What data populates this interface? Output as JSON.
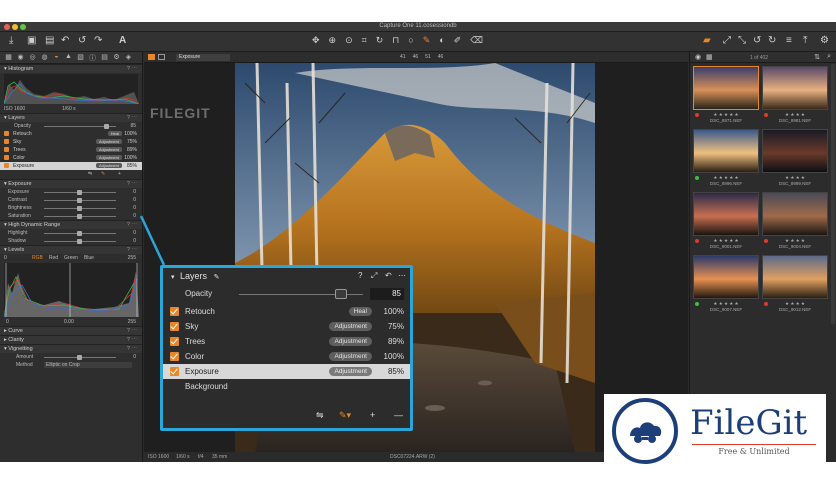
{
  "window": {
    "title": "Capture One 11.cosessiondb"
  },
  "toolbar": {
    "left_icons": [
      "import-icon",
      "camera-icon",
      "folder-icon",
      "undo-icon",
      "redo-icon",
      "text-icon"
    ],
    "center_icons": [
      "pan-icon",
      "loupe-icon",
      "crop-icon",
      "rotate-icon",
      "keystone-icon",
      "mask-icon",
      "brush-icon",
      "eraser-icon",
      "picker-icon"
    ],
    "right_icons": [
      "exposure-warning-icon",
      "expand-icon",
      "compare-icon",
      "rotate-left-icon",
      "rotate-right-icon",
      "settings-icon",
      "export-icon"
    ]
  },
  "left_panel": {
    "histogram": {
      "title": "Histogram",
      "iso": "ISO 1600",
      "shutter": "1/60 s"
    },
    "layers": {
      "title": "Layers",
      "opacity_label": "Opacity",
      "opacity_value": "85",
      "rows": [
        {
          "name": "Retouch",
          "tag": "Heal",
          "pct": "100%"
        },
        {
          "name": "Sky",
          "tag": "Adjustment",
          "pct": "75%"
        },
        {
          "name": "Trees",
          "tag": "Adjustment",
          "pct": "89%"
        },
        {
          "name": "Color",
          "tag": "Adjustment",
          "pct": "100%"
        },
        {
          "name": "Exposure",
          "tag": "Adjustment",
          "pct": "85%"
        }
      ]
    },
    "exposure": {
      "title": "Exposure",
      "rows": [
        "Exposure",
        "Contrast",
        "Brightness",
        "Saturation"
      ],
      "values": [
        "0",
        "0",
        "0",
        "0"
      ]
    },
    "hdr": {
      "title": "High Dynamic Range",
      "rows": [
        "Highlight",
        "Shadow"
      ],
      "values": [
        "0",
        "0"
      ]
    },
    "levels": {
      "title": "Levels",
      "tabs": [
        "RGB",
        "Red",
        "Green",
        "Blue"
      ],
      "low": "0",
      "high": "255",
      "in_low": "0",
      "mid": "0.00",
      "in_high": "255"
    },
    "curve": {
      "title": "Curve"
    },
    "clarity": {
      "title": "Clarity"
    },
    "vignetting": {
      "title": "Vignetting",
      "amount_label": "Amount",
      "amount_value": "0",
      "method_label": "Method",
      "method_value": "Elliptic on Crop"
    }
  },
  "viewer": {
    "preset": "Exposure",
    "zoom_tabs": [
      "41",
      "46",
      "51",
      "46"
    ],
    "bottom_iso": "ISO 1600",
    "bottom_shutter": "1/60 s",
    "bottom_aperture": "f/4",
    "bottom_focal": "35 mm",
    "bottom_file": "DSC07224.ARW (2)"
  },
  "browser": {
    "count": "1 of 402",
    "thumbs": [
      {
        "name": "DSC_8971.NEF",
        "dot": "#e03a2a",
        "stars": "★ ★ ★ ★ ★"
      },
      {
        "name": "DSC_8981.NEF",
        "dot": "#e03a2a",
        "stars": "★ ★ ★ ★"
      },
      {
        "name": "DSC_8996.NEF",
        "dot": "#3bbf3b",
        "stars": "★ ★ ★ ★ ★"
      },
      {
        "name": "DSC_8999.NEF",
        "dot": "",
        "stars": "★ ★ ★ ★"
      },
      {
        "name": "DSC_9001.NEF",
        "dot": "#e03a2a",
        "stars": "★ ★ ★ ★ ★"
      },
      {
        "name": "DSC_9004.NEF",
        "dot": "#e03a2a",
        "stars": "★ ★ ★ ★"
      },
      {
        "name": "DSC_9007.NEF",
        "dot": "#3bbf3b",
        "stars": "★ ★ ★ ★ ★"
      },
      {
        "name": "DSC_9012.NEF",
        "dot": "#e03a2a",
        "stars": "★ ★ ★ ★"
      }
    ]
  },
  "popup": {
    "title": "Layers",
    "opacity_label": "Opacity",
    "opacity_value": "85",
    "rows": [
      {
        "name": "Retouch",
        "tag": "Heal",
        "pct": "100%"
      },
      {
        "name": "Sky",
        "tag": "Adjustment",
        "pct": "75%"
      },
      {
        "name": "Trees",
        "tag": "Adjustment",
        "pct": "89%"
      },
      {
        "name": "Color",
        "tag": "Adjustment",
        "pct": "100%"
      },
      {
        "name": "Exposure",
        "tag": "Adjustment",
        "pct": "85%"
      },
      {
        "name": "Background"
      }
    ]
  },
  "brand": {
    "name": "FileGit",
    "tagline": "Free & Unlimited",
    "watermark": "FILEGIT"
  },
  "colors": {
    "accent": "#e8862a",
    "callout": "#2aa6d8",
    "brand_blue": "#1c3f7a",
    "brand_red": "#e03a2a"
  }
}
